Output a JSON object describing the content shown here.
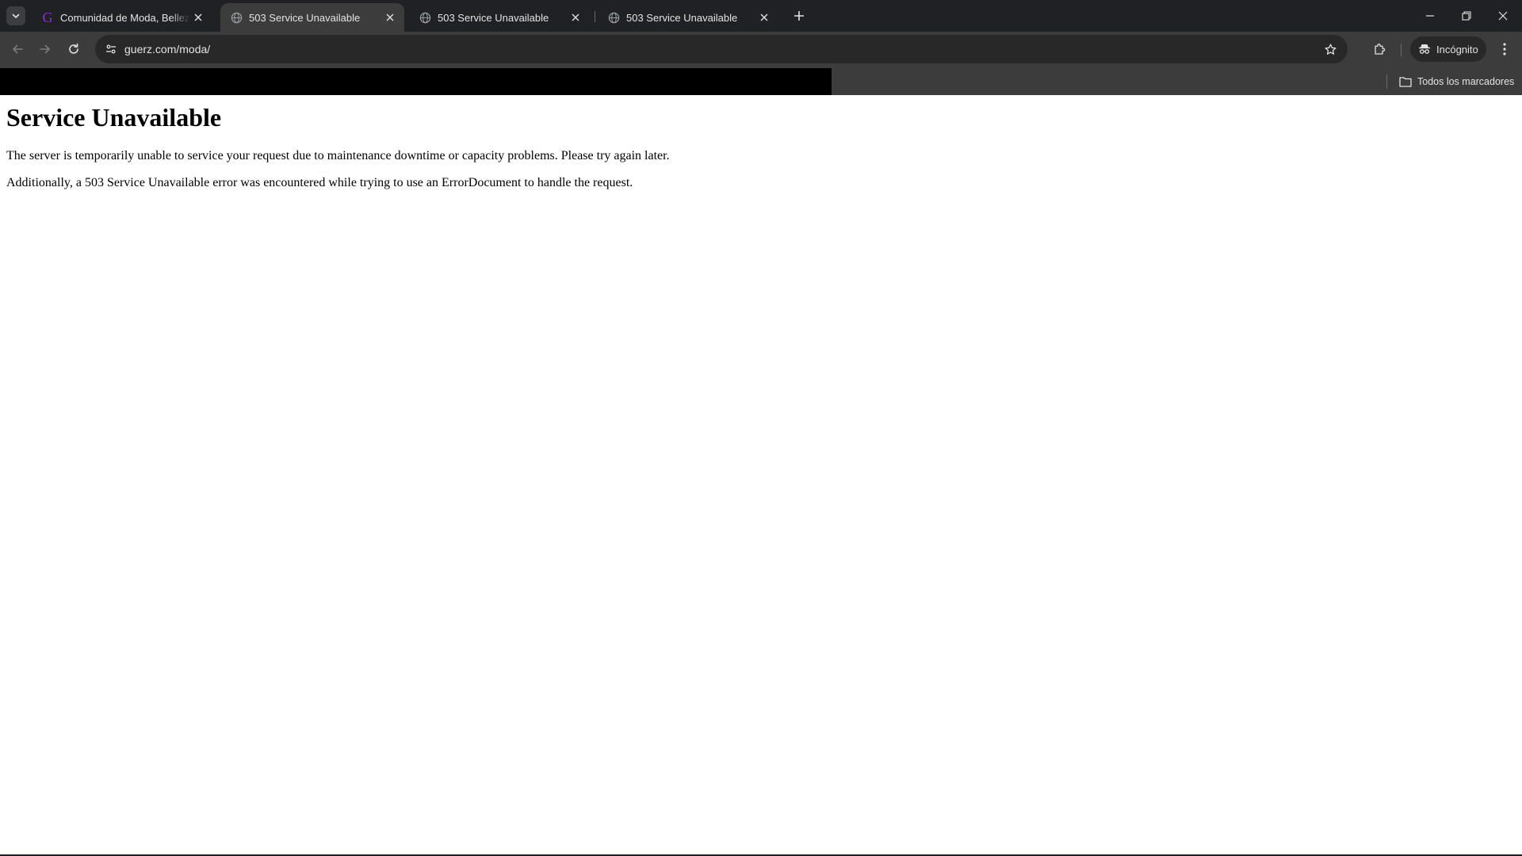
{
  "browser": {
    "tabs": [
      {
        "title": "Comunidad de Moda, Belleza, Estilo de Vida",
        "favicon": "guerz-g-icon",
        "active": false
      },
      {
        "title": "503 Service Unavailable",
        "favicon": "globe-icon",
        "active": true
      },
      {
        "title": "503 Service Unavailable",
        "favicon": "globe-icon",
        "active": false
      },
      {
        "title": "503 Service Unavailable",
        "favicon": "globe-icon",
        "active": false
      }
    ],
    "url": "guerz.com/moda/",
    "incognito_label": "Incógnito",
    "bookmarks_folder_label": "Todos los marcadores",
    "colors": {
      "frame": "#202124",
      "toolbar": "#3c3c3c",
      "omnibox": "#282828",
      "text": "#e3e3e3",
      "guerz_brand": "#8a2be2"
    }
  },
  "page": {
    "heading": "Service Unavailable",
    "paragraph_1": "The server is temporarily unable to service your request due to maintenance downtime or capacity problems. Please try again later.",
    "paragraph_2": "Additionally, a 503 Service Unavailable error was encountered while trying to use an ErrorDocument to handle the request."
  }
}
